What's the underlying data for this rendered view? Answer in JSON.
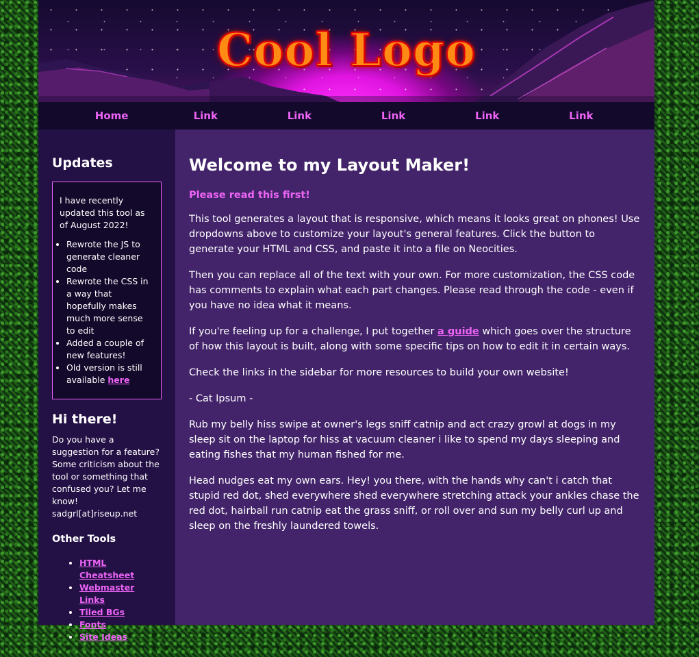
{
  "header": {
    "logo_text": "Cool Logo"
  },
  "nav": {
    "items": [
      {
        "label": "Home"
      },
      {
        "label": "Link"
      },
      {
        "label": "Link"
      },
      {
        "label": "Link"
      },
      {
        "label": "Link"
      },
      {
        "label": "Link"
      }
    ]
  },
  "sidebar": {
    "updates_title": "Updates",
    "updates_intro": "I have recently updated this tool as of August 2022!",
    "updates_items": [
      "Rewrote the JS to generate cleaner code",
      "Rewrote the CSS in a way that hopefully makes much more sense to edit",
      "Added a couple of new features!"
    ],
    "old_version_text": "Old version is still available ",
    "old_version_link": "here",
    "hi_title": "Hi there!",
    "hi_text": "Do you have a suggestion for a feature? Some criticism about the tool or something that confused you? Let me know! sadgrl[at]riseup.net",
    "other_tools_title": "Other Tools",
    "tools": [
      "HTML Cheatsheet",
      "Webmaster Links",
      "Tiled BGs",
      "Fonts",
      "Site Ideas"
    ]
  },
  "main": {
    "title": "Welcome to my Layout Maker!",
    "notice": "Please read this first!",
    "p1": "This tool generates a layout that is responsive, which means it looks great on phones! Use dropdowns above to customize your layout's general features. Click the button to generate your HTML and CSS, and paste it into a file on Neocities.",
    "p2": "Then you can replace all of the text with your own. For more customization, the CSS code has comments to explain what each part changes. Please read through the code - even if you have no idea what it means.",
    "p3_before": "If you're feeling up for a challenge, I put together ",
    "p3_link": "a guide",
    "p3_after": " which goes over the structure of how this layout is built, along with some specific tips on how to edit it in certain ways.",
    "p4": "Check the links in the sidebar for more resources to build your own website!",
    "p5": "- Cat Ipsum -",
    "p6": "Rub my belly hiss swipe at owner's legs sniff catnip and act crazy growl at dogs in my sleep sit on the laptop for hiss at vacuum cleaner i like to spend my days sleeping and eating fishes that my human fished for me.",
    "p7": "Head nudges eat my own ears. Hey! you there, with the hands why can't i catch that stupid red dot, shed everywhere shed everywhere stretching attack your ankles chase the red dot, hairball run catnip eat the grass sniff, or roll over and sun my belly curl up and sleep on the freshly laundered towels."
  },
  "colors": {
    "accent_pink": "#ed64f5",
    "content_bg": "#43246a",
    "sidebar_bg": "#231045",
    "nav_bg": "#13092b"
  }
}
